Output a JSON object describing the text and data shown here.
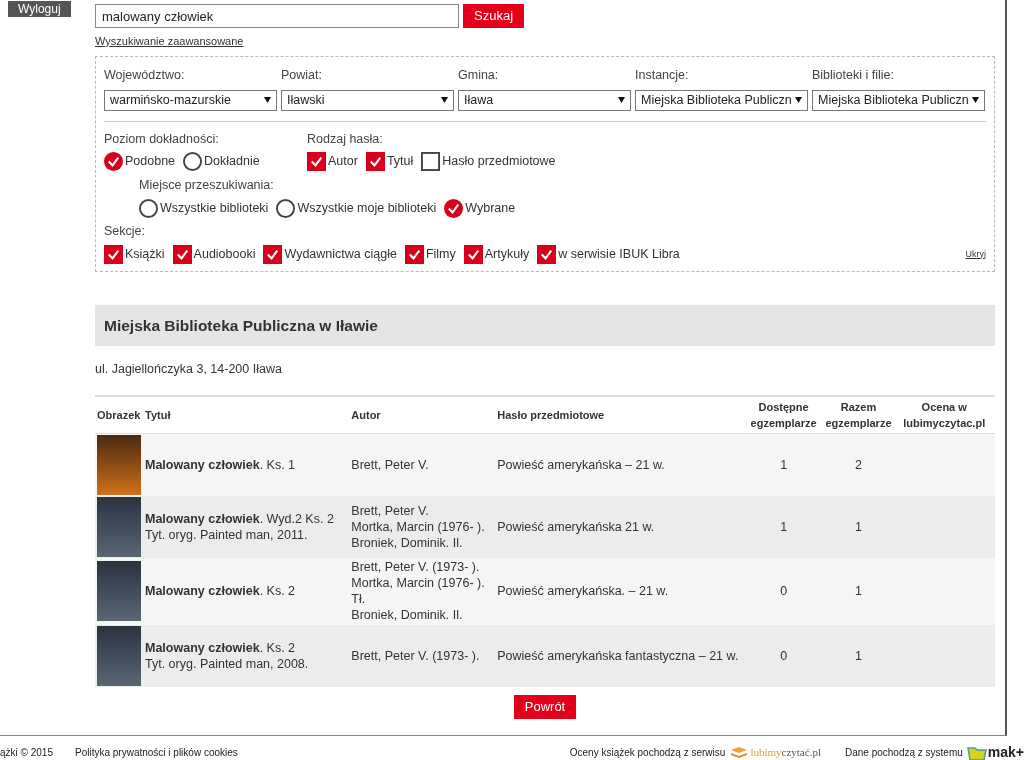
{
  "logout_button": "Wyloguj",
  "search": {
    "value": "malowany człowiek",
    "button": "Szukaj",
    "advanced_link": "Wyszukiwanie zaawansowane"
  },
  "filters": {
    "dropdowns": [
      {
        "label": "Województwo:",
        "value": "warmińsko-mazurskie"
      },
      {
        "label": "Powiat:",
        "value": "Iławski"
      },
      {
        "label": "Gmina:",
        "value": "Iława"
      },
      {
        "label": "Instancje:",
        "value": "Miejska Biblioteka Publiczn"
      },
      {
        "label": "Biblioteki i filie:",
        "value": "Miejska Biblioteka Publiczn"
      }
    ],
    "accuracy": {
      "label": "Poziom dokładności:",
      "options": [
        {
          "label": "Podobne",
          "selected": true
        },
        {
          "label": "Dokładnie",
          "selected": false
        }
      ]
    },
    "term_type": {
      "label": "Rodzaj hasła:",
      "options": [
        {
          "label": "Autor",
          "checked": true
        },
        {
          "label": "Tytuł",
          "checked": true
        },
        {
          "label": "Hasło przedmiotowe",
          "checked": false
        }
      ]
    },
    "search_place": {
      "label": "Miejsce przeszukiwania:",
      "options": [
        {
          "label": "Wszystkie biblioteki",
          "selected": false
        },
        {
          "label": "Wszystkie moje biblioteki",
          "selected": false
        },
        {
          "label": "Wybrane",
          "selected": true
        }
      ]
    },
    "sections": {
      "label": "Sekcje:",
      "options": [
        {
          "label": "Książki",
          "checked": true
        },
        {
          "label": "Audiobooki",
          "checked": true
        },
        {
          "label": "Wydawnictwa ciągłe",
          "checked": true
        },
        {
          "label": "Filmy",
          "checked": true
        },
        {
          "label": "Artykuły",
          "checked": true
        },
        {
          "label": "w serwisie IBUK Libra",
          "checked": true
        }
      ]
    },
    "hide_link": "Ukryj"
  },
  "library": {
    "name": "Miejska Biblioteka Publiczna w Iławie",
    "address": "ul. Jagiellończyka 3, 14-200 Iława"
  },
  "table": {
    "columns": [
      "Obrazek",
      "Tytuł",
      "Autor",
      "Hasło przedmiotowe",
      "Dostępne egzemplarze",
      "Razem egzemplarze",
      "Ocena w lubimyczytac.pl"
    ],
    "rows": [
      {
        "title": "**Malowany człowiek**. Ks. 1",
        "note": "",
        "authors": [
          "Brett, Peter V."
        ],
        "subject": "Powieść amerykańska – 21 w.",
        "available": "1",
        "total": "2"
      },
      {
        "title": "**Malowany człowiek**. Wyd.2 Ks. 2",
        "note": "Tyt. oryg. Painted man, 2011.",
        "authors": [
          "Brett, Peter V.",
          "Mortka, Marcin (1976- ).",
          "Broniek, Dominik. Il."
        ],
        "subject": "Powieść amerykańska 21 w.",
        "available": "1",
        "total": "1"
      },
      {
        "title": "**Malowany człowiek**. Ks. 2",
        "note": "",
        "authors": [
          "Brett, Peter V. (1973- ).",
          "Mortka, Marcin (1976- ).",
          "Tł.",
          "Broniek, Dominik. Il."
        ],
        "subject": "Powieść amerykańska. – 21 w.",
        "available": "0",
        "total": "1"
      },
      {
        "title": "**Malowany człowiek**. Ks. 2",
        "note": "Tyt. oryg. Painted man, 2008.",
        "authors": [
          "Brett, Peter V. (1973- )."
        ],
        "subject": "Powieść amerykańska fantastyczna – 21 w.",
        "available": "0",
        "total": "1"
      }
    ]
  },
  "back_button": "Powrót",
  "footer": {
    "copyright": "ążki © 2015",
    "privacy_link": "Polityka prywatności i plików cookies",
    "ratings_text": "Oceny książek pochodzą z serwisu",
    "ratings_logo": [
      "lubimy",
      "czytać.pl"
    ],
    "data_text": "Dane pochodzą z systemu",
    "system_logo": "mak+"
  }
}
